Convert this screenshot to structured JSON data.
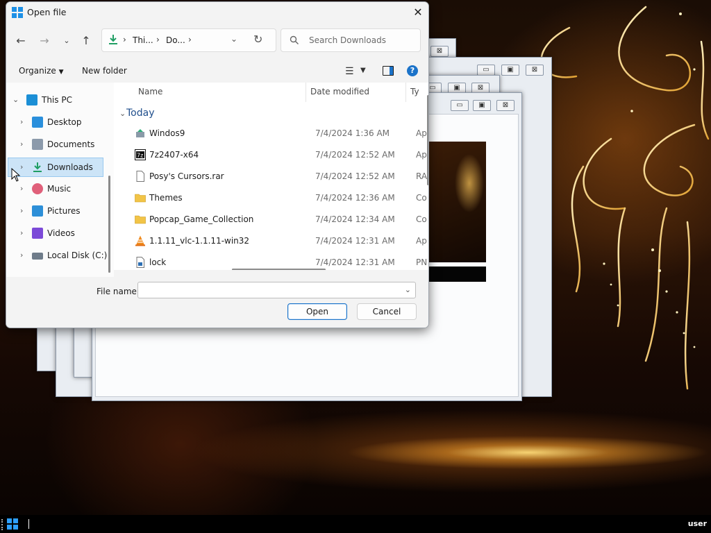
{
  "dialog": {
    "title": "Open file",
    "close_glyph": "✕",
    "address": {
      "seg1": "Thi...",
      "seg2": "Do...",
      "sep": "›"
    },
    "search_placeholder": "Search Downloads",
    "commands": {
      "organize": "Organize",
      "new_folder": "New folder"
    },
    "nav": {
      "items": [
        {
          "label": "This PC",
          "icon": "pc-icon",
          "color": "#1b8fd6"
        },
        {
          "label": "Desktop",
          "icon": "desktop-icon",
          "color": "#2a8fdc"
        },
        {
          "label": "Documents",
          "icon": "documents-icon",
          "color": "#8c9aab"
        },
        {
          "label": "Downloads",
          "icon": "downloads-icon",
          "color": "#1f9e63"
        },
        {
          "label": "Music",
          "icon": "music-icon",
          "color": "#e0607a"
        },
        {
          "label": "Pictures",
          "icon": "pictures-icon",
          "color": "#2d8fd8"
        },
        {
          "label": "Videos",
          "icon": "videos-icon",
          "color": "#7c4ad8"
        },
        {
          "label": "Local Disk (C:)",
          "icon": "disk-icon",
          "color": "#6f7c8a"
        }
      ]
    },
    "columns": {
      "name": "Name",
      "date": "Date modified",
      "type": "Ty"
    },
    "group": "Today",
    "files": [
      {
        "name": "Windos9",
        "date": "7/4/2024 1:36 AM",
        "type": "Ap",
        "icon": "app-icon"
      },
      {
        "name": "7z2407-x64",
        "date": "7/4/2024 12:52 AM",
        "type": "Ap",
        "icon": "7zip-icon"
      },
      {
        "name": "Posy's Cursors.rar",
        "date": "7/4/2024 12:52 AM",
        "type": "RA",
        "icon": "file-icon"
      },
      {
        "name": "Themes",
        "date": "7/4/2024 12:36 AM",
        "type": "Co",
        "icon": "folder-icon"
      },
      {
        "name": "Popcap_Game_Collection",
        "date": "7/4/2024 12:34 AM",
        "type": "Co",
        "icon": "folder-icon"
      },
      {
        "name": "1.1.11_vlc-1.1.11-win32",
        "date": "7/4/2024 12:31 AM",
        "type": "Ap",
        "icon": "vlc-icon"
      },
      {
        "name": "lock",
        "date": "7/4/2024 12:31 AM",
        "type": "PN",
        "icon": "image-file-icon"
      }
    ],
    "file_name_label": "File name:",
    "file_name_value": "",
    "open_label": "Open",
    "cancel_label": "Cancel"
  },
  "bg_windows": {
    "min": "▭",
    "max": "▣",
    "close": "⊠"
  },
  "taskbar": {
    "user": "user"
  }
}
